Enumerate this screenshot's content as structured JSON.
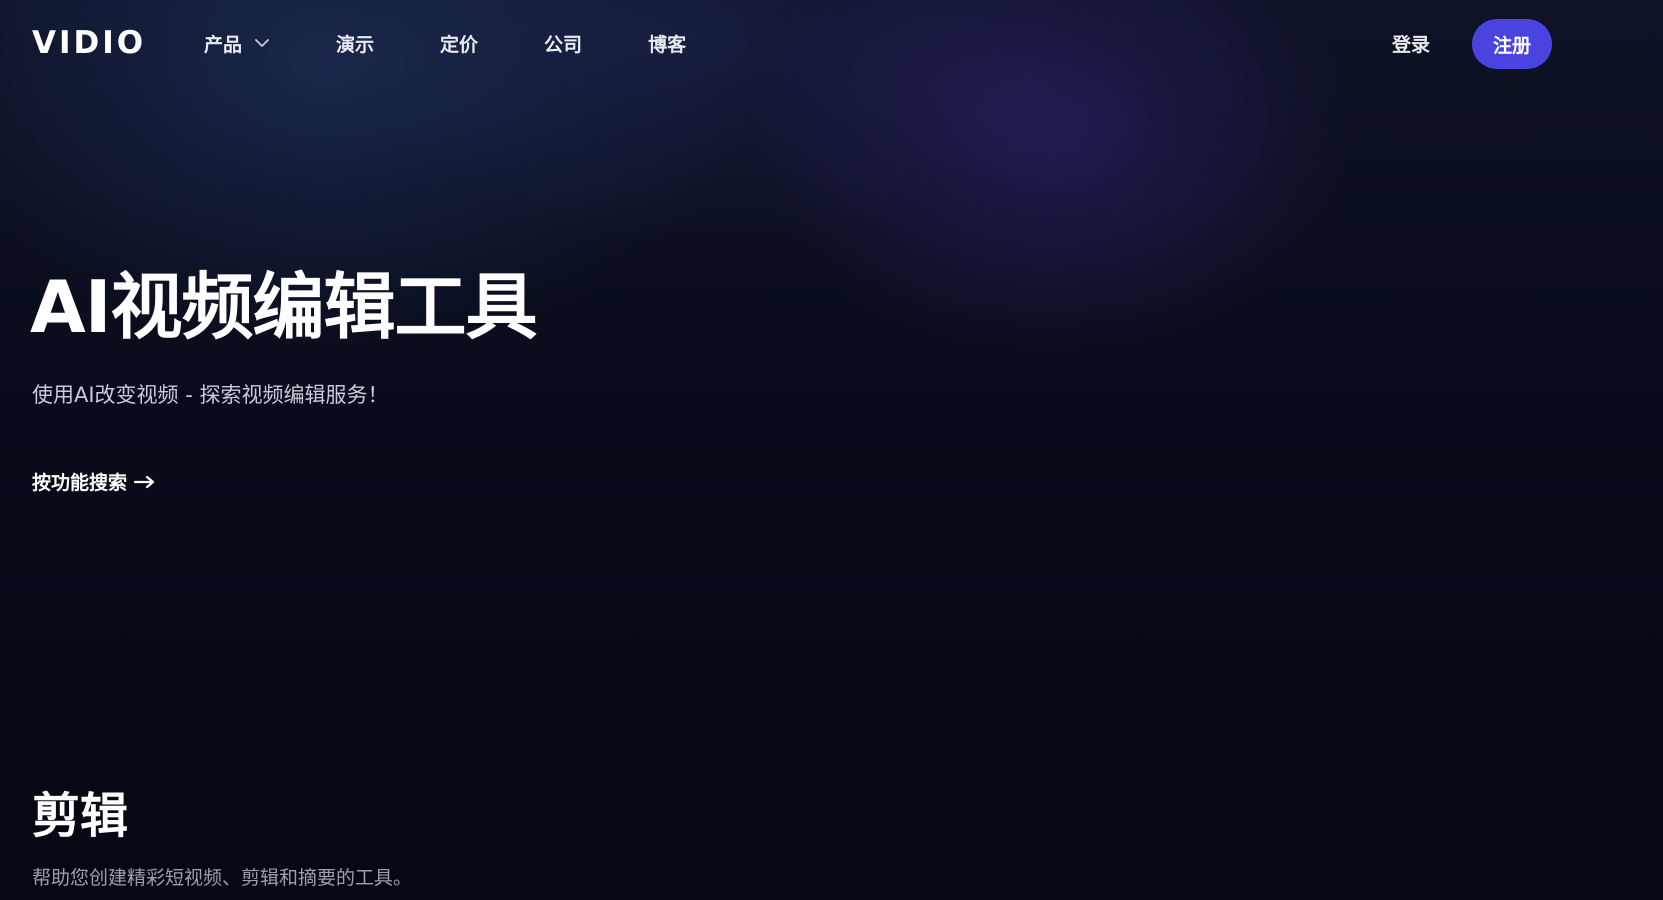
{
  "brand": {
    "logo_text": "VIDIO"
  },
  "nav": {
    "items": [
      {
        "label": "产品",
        "has_dropdown": true,
        "icon": "chevron-down-icon"
      },
      {
        "label": "演示"
      },
      {
        "label": "定价"
      },
      {
        "label": "公司"
      },
      {
        "label": "博客"
      }
    ],
    "login_label": "登录",
    "signup_label": "注册"
  },
  "hero": {
    "title": "AI视频编辑工具",
    "subtitle": "使用AI改变视频 - 探索视频编辑服务！",
    "feature_search_label": "按功能搜索",
    "feature_search_icon": "arrow-right-icon"
  },
  "section": {
    "title": "剪辑",
    "description": "帮助您创建精彩短视频、剪辑和摘要的工具。"
  },
  "colors": {
    "background": "#060913",
    "accent": "#4a43e0",
    "text_primary": "#ffffff",
    "text_secondary": "#c9ccd8",
    "text_muted": "#9aa0b2"
  }
}
